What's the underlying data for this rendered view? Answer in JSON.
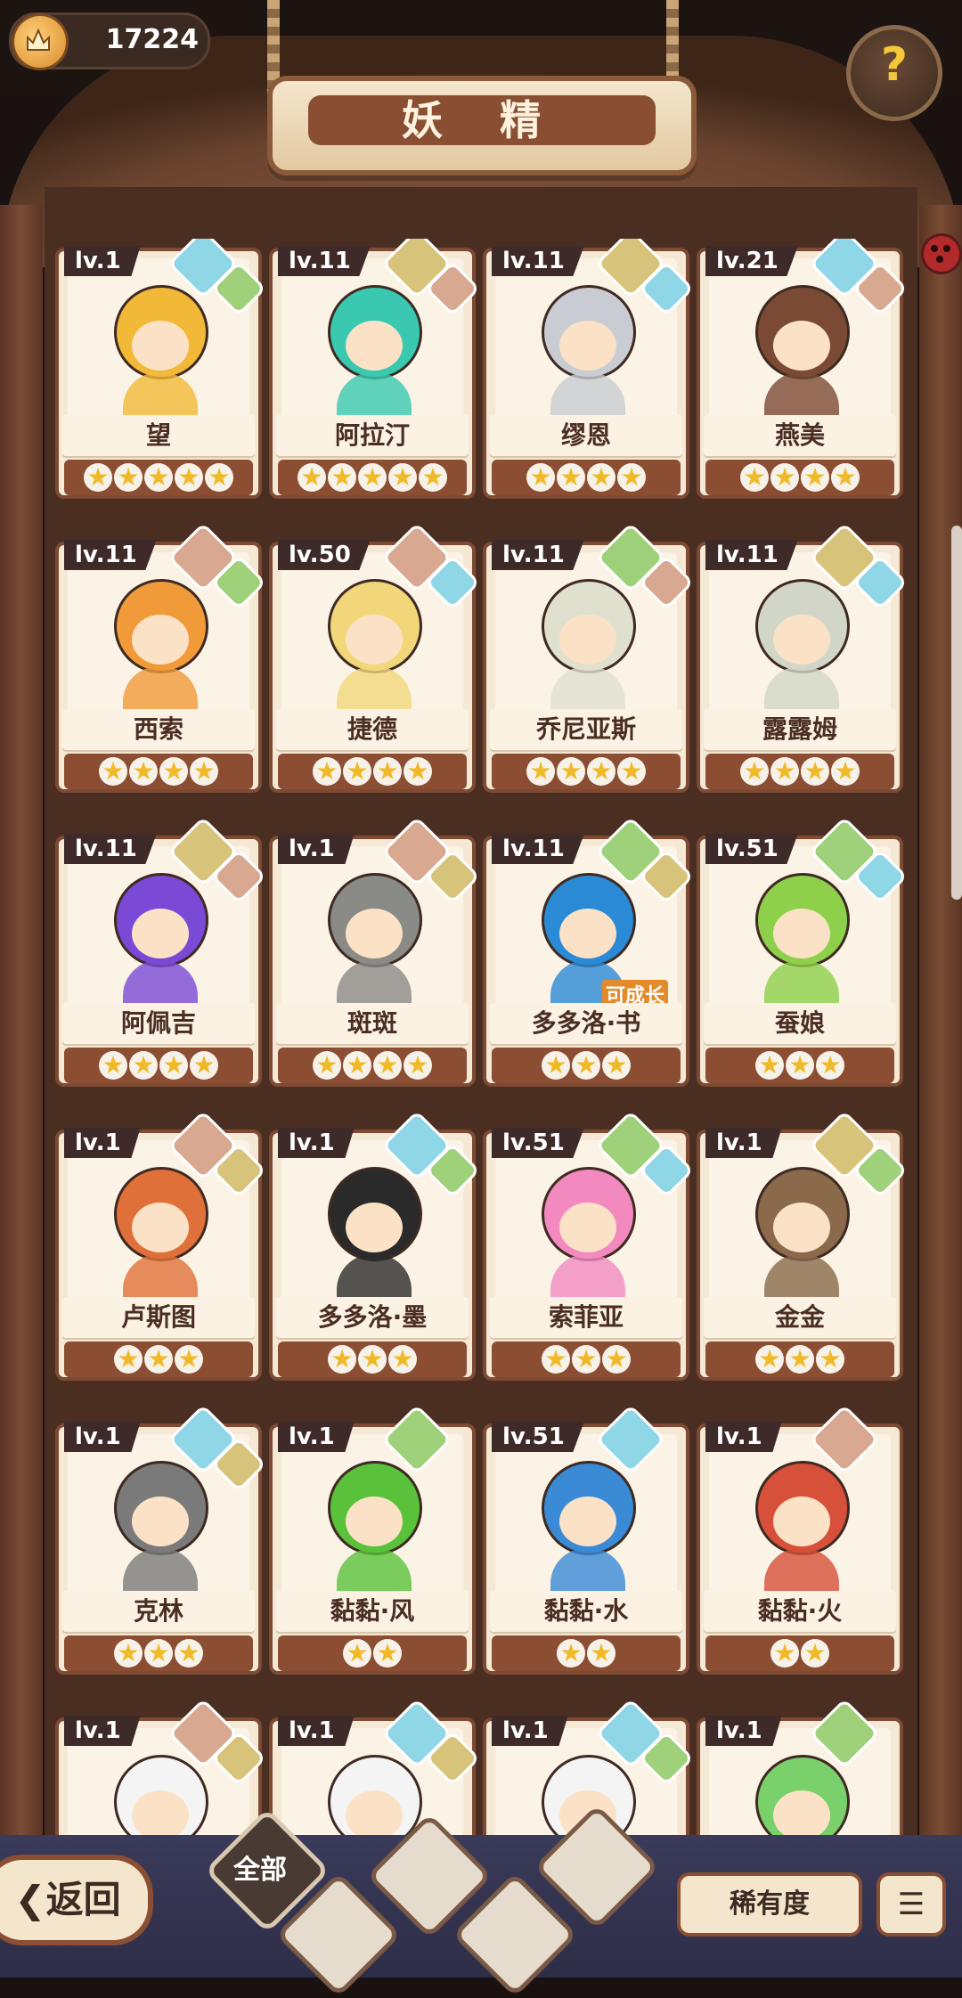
{
  "header": {
    "coin_value": "17224",
    "title": "妖 精",
    "help_label": "?"
  },
  "filters": {
    "all_label": "全部",
    "sort_label": "稀有度",
    "order_icon": "sort-list-icon",
    "back_label": "返回"
  },
  "tag_label": "可成长",
  "colors": {
    "frame": "#7d4a34",
    "star": "#f0b927",
    "banner": "#fbf2e4"
  },
  "cards": [
    {
      "level": "lv.1",
      "name": "望",
      "stars": 5,
      "badges": [
        "water",
        "leaf"
      ],
      "color": "#f2b938"
    },
    {
      "level": "lv.11",
      "name": "阿拉汀",
      "stars": 5,
      "badges": [
        "earth",
        "fire"
      ],
      "color": "#3ac9b0"
    },
    {
      "level": "lv.11",
      "name": "缪恩",
      "stars": 4,
      "badges": [
        "earth",
        "water"
      ],
      "color": "#c9ccd2"
    },
    {
      "level": "lv.21",
      "name": "燕美",
      "stars": 4,
      "badges": [
        "water",
        "fire"
      ],
      "color": "#7a4a34"
    },
    {
      "level": "lv.11",
      "name": "西索",
      "stars": 4,
      "badges": [
        "fire",
        "leaf"
      ],
      "color": "#f09a3a"
    },
    {
      "level": "lv.50",
      "name": "捷德",
      "stars": 4,
      "badges": [
        "fire",
        "water"
      ],
      "color": "#f2d77a"
    },
    {
      "level": "lv.11",
      "name": "乔尼亚斯",
      "stars": 4,
      "badges": [
        "leaf",
        "fire"
      ],
      "color": "#e0e0cf"
    },
    {
      "level": "lv.11",
      "name": "露露姆",
      "stars": 4,
      "badges": [
        "earth",
        "water"
      ],
      "color": "#d2d6c8"
    },
    {
      "level": "lv.11",
      "name": "阿佩吉",
      "stars": 4,
      "badges": [
        "earth",
        "fire"
      ],
      "color": "#7a4ad6"
    },
    {
      "level": "lv.1",
      "name": "斑斑",
      "stars": 4,
      "badges": [
        "fire",
        "earth"
      ],
      "color": "#8a8a86"
    },
    {
      "level": "lv.11",
      "name": "多多洛·书",
      "stars": 3,
      "badges": [
        "leaf",
        "earth"
      ],
      "color": "#2a8ad6",
      "tag": true
    },
    {
      "level": "lv.51",
      "name": "蚕娘",
      "stars": 3,
      "badges": [
        "leaf",
        "water"
      ],
      "color": "#8fd04a"
    },
    {
      "level": "lv.1",
      "name": "卢斯图",
      "stars": 3,
      "badges": [
        "fire",
        "earth"
      ],
      "color": "#e0703a"
    },
    {
      "level": "lv.1",
      "name": "多多洛·墨",
      "stars": 3,
      "badges": [
        "water",
        "leaf"
      ],
      "color": "#2a2a2a"
    },
    {
      "level": "lv.51",
      "name": "索菲亚",
      "stars": 3,
      "badges": [
        "leaf",
        "water"
      ],
      "color": "#f28ac0"
    },
    {
      "level": "lv.1",
      "name": "金金",
      "stars": 3,
      "badges": [
        "earth",
        "leaf"
      ],
      "color": "#8a6a4a"
    },
    {
      "level": "lv.1",
      "name": "克林",
      "stars": 3,
      "badges": [
        "water",
        "earth"
      ],
      "color": "#7a7a7a"
    },
    {
      "level": "lv.1",
      "name": "黏黏·风",
      "stars": 2,
      "badges": [
        "leaf"
      ],
      "color": "#5ac23a"
    },
    {
      "level": "lv.51",
      "name": "黏黏·水",
      "stars": 2,
      "badges": [
        "water"
      ],
      "color": "#3a8ad6"
    },
    {
      "level": "lv.1",
      "name": "黏黏·火",
      "stars": 2,
      "badges": [
        "fire"
      ],
      "color": "#d6503a"
    },
    {
      "level": "lv.1",
      "name": "",
      "stars": 0,
      "badges": [
        "fire",
        "earth"
      ],
      "color": "#f4f4f4"
    },
    {
      "level": "lv.1",
      "name": "",
      "stars": 0,
      "badges": [
        "water",
        "earth"
      ],
      "color": "#f4f4f4"
    },
    {
      "level": "lv.1",
      "name": "",
      "stars": 0,
      "badges": [
        "water",
        "leaf"
      ],
      "color": "#f4f4f4"
    },
    {
      "level": "lv.1",
      "name": "",
      "stars": 0,
      "badges": [
        "leaf"
      ],
      "color": "#7ad06a"
    }
  ]
}
